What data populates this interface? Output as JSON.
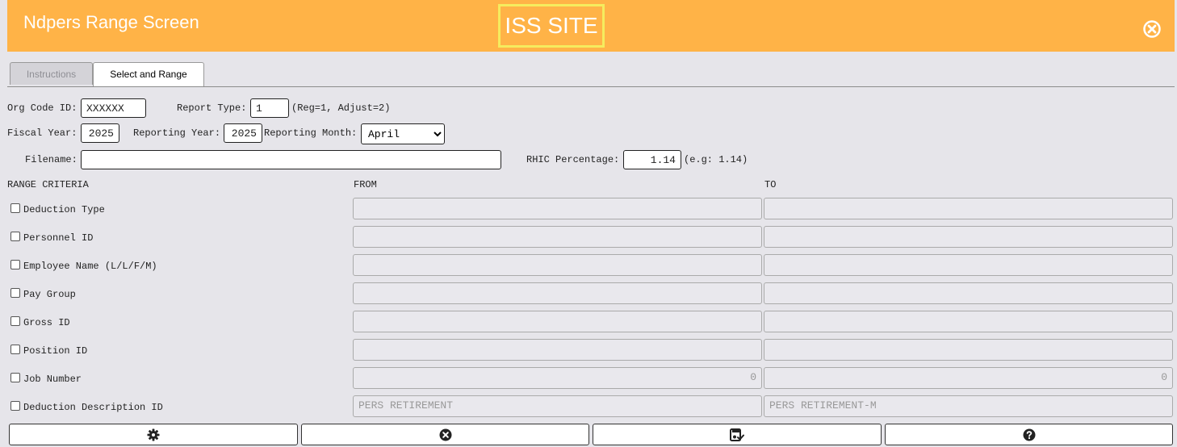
{
  "header": {
    "title": "Ndpers Range Screen",
    "site_badge": "ISS SITE"
  },
  "tabs": [
    {
      "label": "Instructions",
      "active": false
    },
    {
      "label": "Select and Range",
      "active": true
    }
  ],
  "form": {
    "org_code_label": "Org Code ID:",
    "org_code_value": "XXXXXX",
    "report_type_label": "Report Type:",
    "report_type_value": "1",
    "report_type_hint": "(Reg=1, Adjust=2)",
    "fiscal_year_label": "Fiscal Year:",
    "fiscal_year_value": "2025",
    "reporting_year_label": "Reporting Year:",
    "reporting_year_value": "2025",
    "reporting_month_label": "Reporting Month:",
    "reporting_month_value": "April",
    "filename_label": "Filename:",
    "filename_value": "",
    "rhic_label": "RHIC Percentage:",
    "rhic_value": "1.14",
    "rhic_hint": "(e.g: 1.14)"
  },
  "range": {
    "header_criteria": "RANGE CRITERIA",
    "header_from": "FROM",
    "header_to": "TO",
    "rows": [
      {
        "label": "Deduction Type",
        "from": "",
        "to": ""
      },
      {
        "label": "Personnel ID",
        "from": "",
        "to": ""
      },
      {
        "label": "Employee Name (L/L/F/M)",
        "from": "",
        "to": ""
      },
      {
        "label": "Pay Group",
        "from": "",
        "to": ""
      },
      {
        "label": "Gross ID",
        "from": "",
        "to": ""
      },
      {
        "label": "Position ID",
        "from": "",
        "to": ""
      },
      {
        "label": "Job Number",
        "from": "0",
        "to": "0"
      },
      {
        "label": "Deduction Description ID",
        "from": "PERS RETIREMENT",
        "to": "PERS RETIREMENT-M"
      }
    ]
  },
  "toolbar": {
    "icons": [
      "gear-icon",
      "cancel-icon",
      "save-icon",
      "help-icon"
    ]
  },
  "colors": {
    "header_bg": "#ffb347",
    "badge_border": "#f5ec5e",
    "page_bg": "#e6e5ea"
  }
}
